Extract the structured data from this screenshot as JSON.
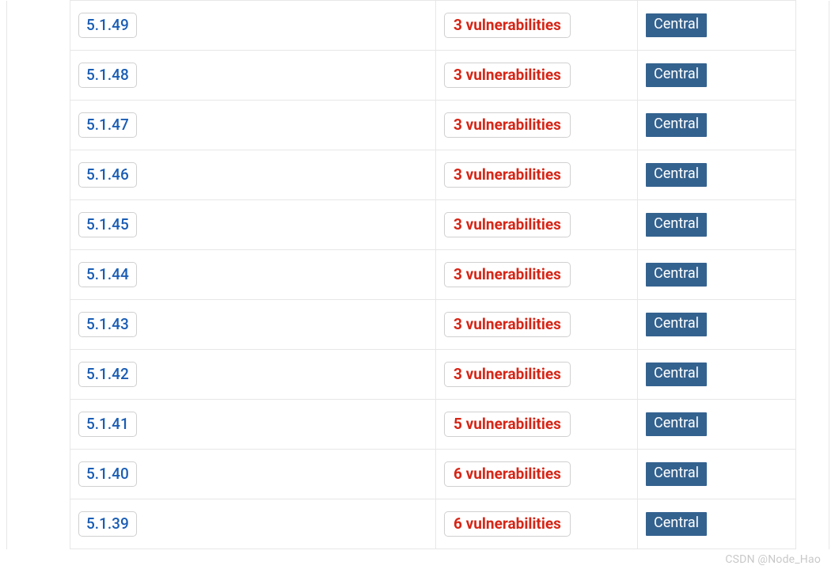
{
  "rows": [
    {
      "version": "5.1.49",
      "vuln": "3 vulnerabilities",
      "repo": "Central"
    },
    {
      "version": "5.1.48",
      "vuln": "3 vulnerabilities",
      "repo": "Central"
    },
    {
      "version": "5.1.47",
      "vuln": "3 vulnerabilities",
      "repo": "Central"
    },
    {
      "version": "5.1.46",
      "vuln": "3 vulnerabilities",
      "repo": "Central"
    },
    {
      "version": "5.1.45",
      "vuln": "3 vulnerabilities",
      "repo": "Central"
    },
    {
      "version": "5.1.44",
      "vuln": "3 vulnerabilities",
      "repo": "Central"
    },
    {
      "version": "5.1.43",
      "vuln": "3 vulnerabilities",
      "repo": "Central"
    },
    {
      "version": "5.1.42",
      "vuln": "3 vulnerabilities",
      "repo": "Central"
    },
    {
      "version": "5.1.41",
      "vuln": "5 vulnerabilities",
      "repo": "Central"
    },
    {
      "version": "5.1.40",
      "vuln": "6 vulnerabilities",
      "repo": "Central"
    },
    {
      "version": "5.1.39",
      "vuln": "6 vulnerabilities",
      "repo": "Central"
    }
  ],
  "watermark": "CSDN @Node_Hao"
}
